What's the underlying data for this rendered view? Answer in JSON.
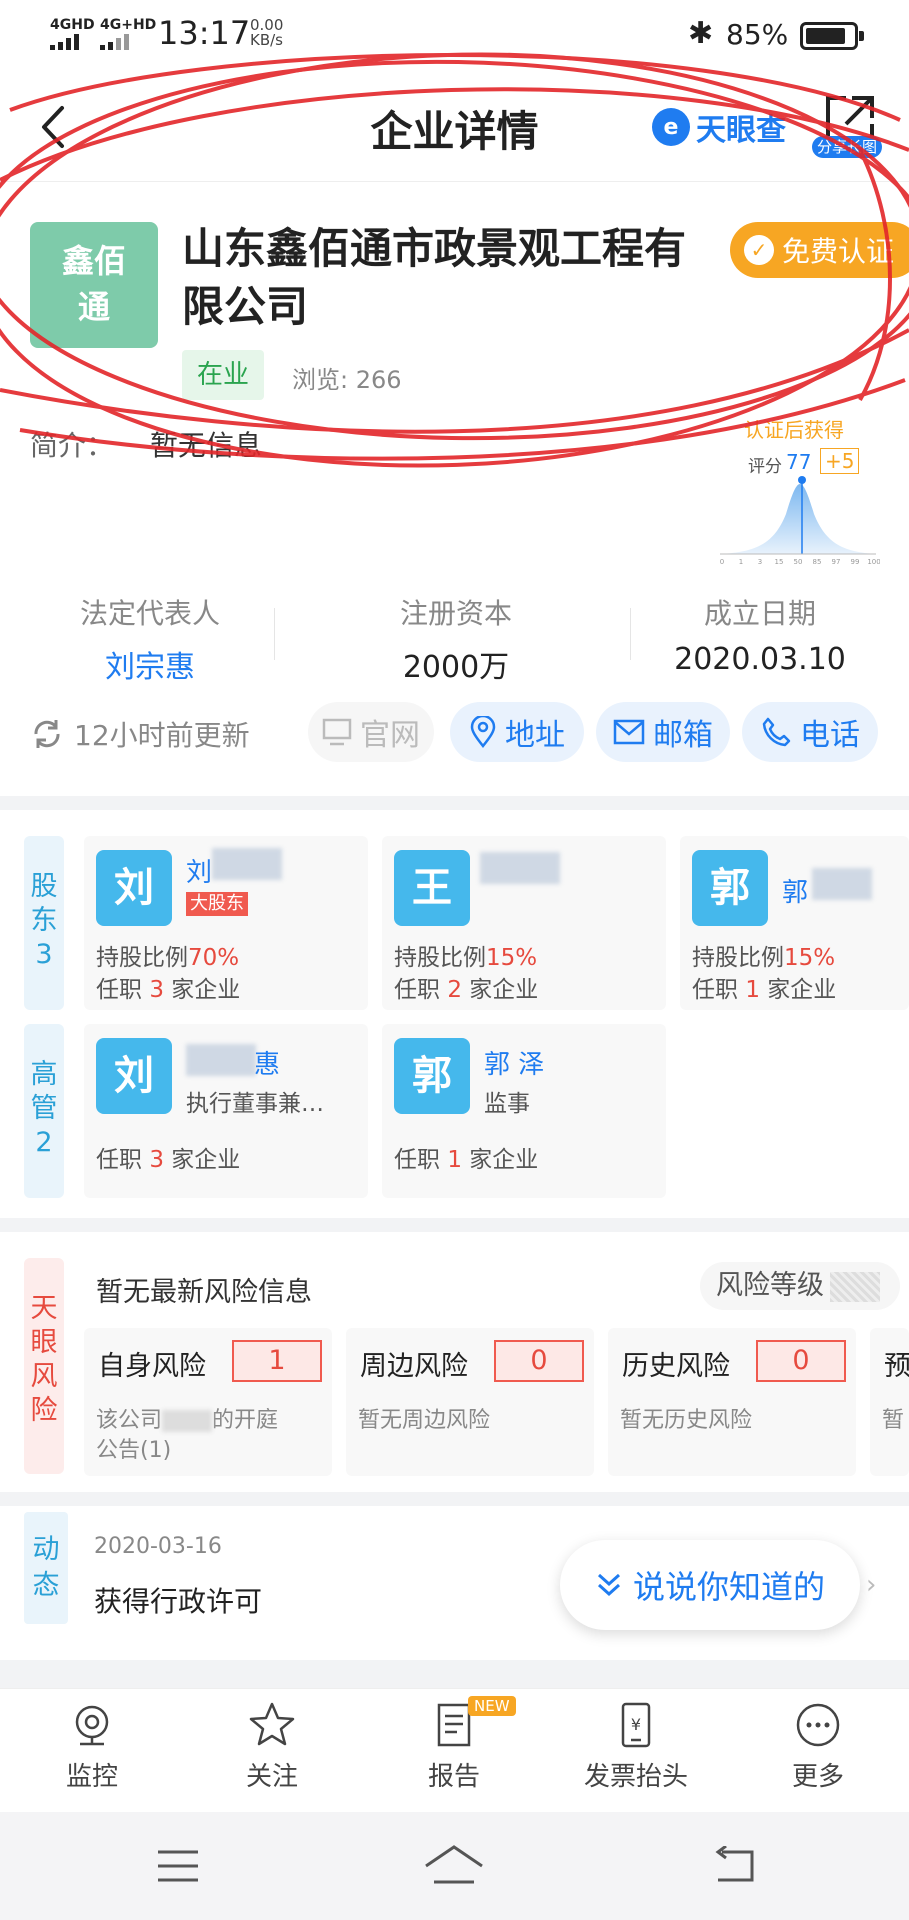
{
  "status_bar": {
    "network_1": "4GHD",
    "network_2": "4G+HD",
    "time": "13:17",
    "speed_value": "0.00",
    "speed_unit": "KB/s",
    "battery_pct": "85%",
    "battery_level": 0.85
  },
  "nav": {
    "title": "企业详情",
    "brand": "天眼查",
    "share_badge": "分享长图"
  },
  "company": {
    "logo_line1": "鑫佰",
    "logo_line2": "通",
    "name": "山东鑫佰通市政景观工程有限公司",
    "cert_label": "免费认证",
    "status": "在业",
    "views": "浏览: 266",
    "intro_label": "简介：",
    "intro_value": "暂无信息"
  },
  "score": {
    "title": "认证后获得",
    "label": "评分",
    "value": "77",
    "plus": "+5",
    "ticks": [
      "0",
      "1",
      "3",
      "15",
      "50",
      "85",
      "97",
      "99",
      "100"
    ]
  },
  "key_info": {
    "legal_label": "法定代表人",
    "legal_value": "刘宗惠",
    "capital_label": "注册资本",
    "capital_value": "2000万",
    "date_label": "成立日期",
    "date_value": "2020.03.10"
  },
  "actions": {
    "update": "12小时前更新",
    "website": "官网",
    "address": "地址",
    "email": "邮箱",
    "phone": "电话"
  },
  "shareholders": {
    "tag_line1": "股",
    "tag_line2": "东",
    "count": "3",
    "items": [
      {
        "avatar": "刘",
        "name": "刘",
        "badge": "大股东",
        "ratio_label": "持股比例",
        "ratio": "70%",
        "job_prefix": "任职",
        "job_count": "3",
        "job_suffix": "家企业"
      },
      {
        "avatar": "王",
        "name": "",
        "ratio_label": "持股比例",
        "ratio": "15%",
        "job_prefix": "任职",
        "job_count": "2",
        "job_suffix": "家企业"
      },
      {
        "avatar": "郭",
        "name": "郭",
        "ratio_label": "持股比例",
        "ratio": "15%",
        "job_prefix": "任职",
        "job_count": "1",
        "job_suffix": "家企业"
      }
    ]
  },
  "executives": {
    "tag_line1": "高",
    "tag_line2": "管",
    "count": "2",
    "items": [
      {
        "avatar": "刘",
        "name": "惠",
        "role": "执行董事兼…",
        "job_prefix": "任职",
        "job_count": "3",
        "job_suffix": "家企业"
      },
      {
        "avatar": "郭",
        "name": "郭 泽",
        "role": "监事",
        "job_prefix": "任职",
        "job_count": "1",
        "job_suffix": "家企业"
      }
    ]
  },
  "risk": {
    "tag": [
      "天",
      "眼",
      "风",
      "险"
    ],
    "head": "暂无最新风险信息",
    "level_label": "风险等级",
    "cards": [
      {
        "title": "自身风险",
        "count": "1",
        "desc1": "该公司",
        "desc1b": "的开庭",
        "desc2": "公告(1)"
      },
      {
        "title": "周边风险",
        "count": "0",
        "desc1": "暂无周边风险"
      },
      {
        "title": "历史风险",
        "count": "0",
        "desc1": "暂无历史风险"
      },
      {
        "title": "预",
        "desc1": "暂"
      }
    ]
  },
  "news": {
    "tag_line1": "动",
    "tag_line2": "态",
    "date": "2020-03-16",
    "text": "获得行政许可",
    "float_label": "说说你知道的"
  },
  "toolbar": {
    "monitor": "监控",
    "follow": "关注",
    "report": "报告",
    "report_badge": "NEW",
    "invoice": "发票抬头",
    "more": "更多"
  }
}
